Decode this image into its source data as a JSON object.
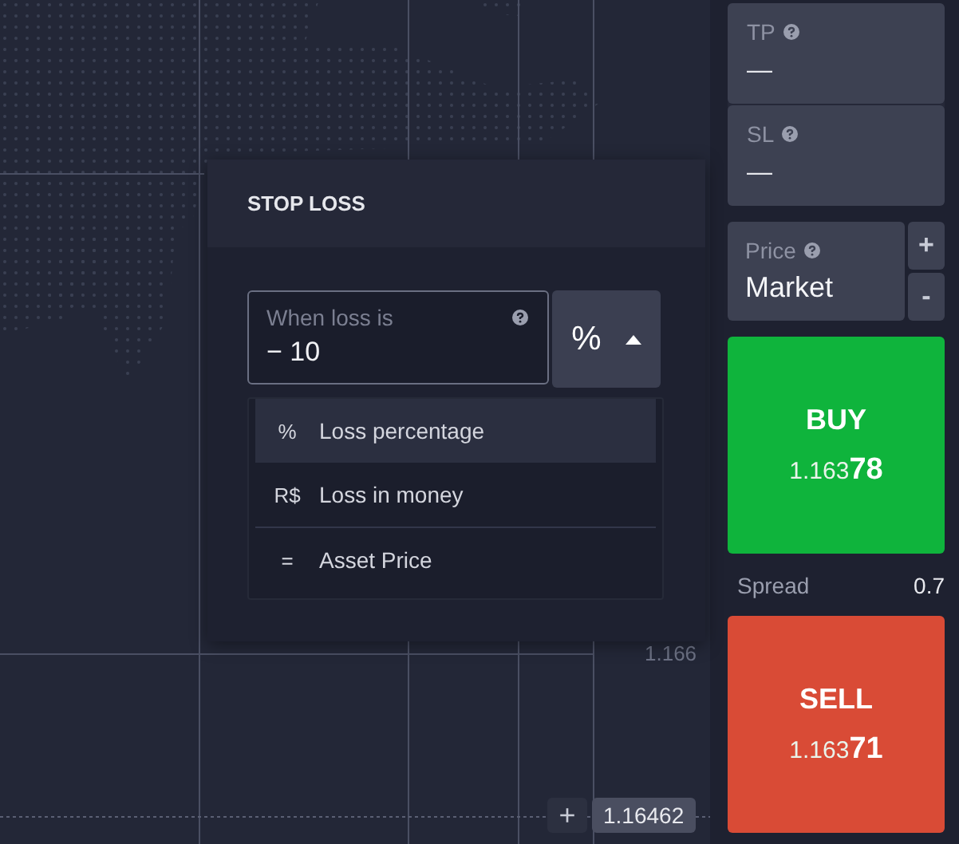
{
  "chart": {
    "axis_label": "1.166",
    "price_tag": {
      "plus": "+",
      "value": "1.16462"
    }
  },
  "stop_loss": {
    "title": "STOP LOSS",
    "field": {
      "label": "When loss is",
      "value": "− 10"
    },
    "unit": {
      "symbol": "%",
      "expanded": true
    },
    "options": [
      {
        "symbol": "%",
        "label": "Loss percentage",
        "selected": true
      },
      {
        "symbol": "R$",
        "label": "Loss in money",
        "selected": false
      },
      {
        "symbol": "=",
        "label": "Asset Price",
        "selected": false
      }
    ]
  },
  "side_panel": {
    "tp": {
      "label": "TP",
      "value": "—"
    },
    "sl": {
      "label": "SL",
      "value": "—"
    },
    "price": {
      "label": "Price",
      "value": "Market",
      "plus": "+",
      "minus": "-"
    },
    "trades": [
      {
        "kind": "buy",
        "label": "BUY",
        "price_main": "1.163",
        "price_pips": "78"
      },
      {
        "kind": "sell",
        "label": "SELL",
        "price_main": "1.163",
        "price_pips": "71"
      }
    ],
    "spread": {
      "label": "Spread",
      "value": "0.7"
    }
  }
}
